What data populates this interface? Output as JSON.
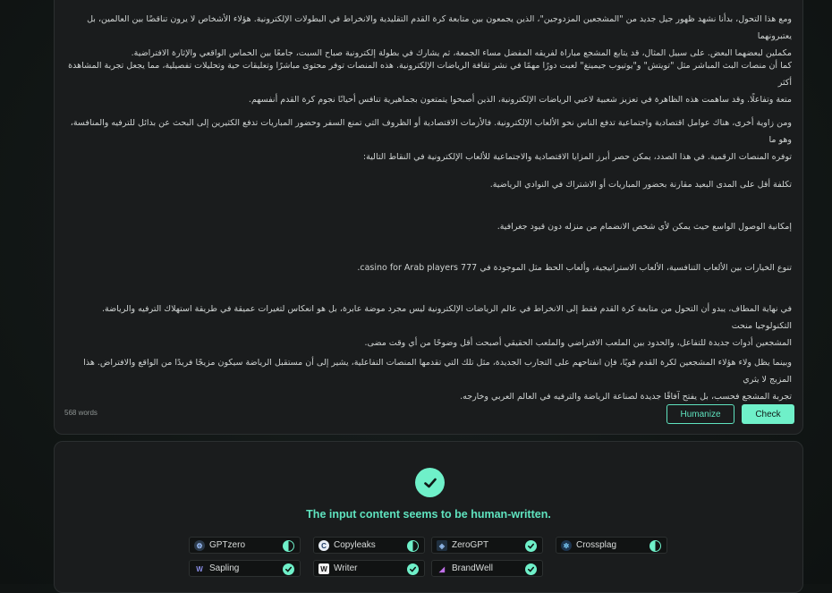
{
  "editor": {
    "paragraphs": [
      [
        "ومع هذا التحول، بدأنا نشهد ظهور جيل جديد من \"المشجعين المزدوجين\"، الذين يجمعون بين متابعة كرة القدم التقليدية والانخراط في البطولات الإلكترونية. هؤلاء الأشخاص لا يرون تناقضًا بين العالمين، بل يعتبرونهما",
        "مكملين لبعضهما البعض. على سبيل المثال، قد يتابع المشجع مباراة لفريقه المفضل مساء الجمعة، ثم يشارك في بطولة إلكترونية صباح السبت، جامعًا بين الحماس الواقعي والإثارة الافتراضية."
      ],
      [
        "كما أن منصات البث المباشر مثل \"تويتش\" و\"يوتيوب جيمينغ\" لعبت دورًا مهمًا في نشر ثقافة الرياضات الإلكترونية. هذه المنصات توفر محتوى مباشرًا وتعليقات حية وتحليلات تفصيلية، مما يجعل تجربة المشاهدة أكثر",
        "متعة وتفاعلًا. وقد ساهمت هذه الظاهرة في تعزيز شعبية لاعبي الرياضات الإلكترونية، الذين أصبحوا يتمتعون بجماهيرية تنافس أحيانًا نجوم كرة القدم أنفسهم."
      ],
      [
        "ومن زاوية أخرى، هناك عوامل اقتصادية واجتماعية تدفع الناس نحو الألعاب الإلكترونية. فالأزمات الاقتصادية أو الظروف التي تمنع السفر وحضور المباريات تدفع الكثيرين إلى البحث عن بدائل للترفيه والمنافسة، وهو ما",
        "توفره المنصات الرقمية. في هذا الصدد، يمكن حصر أبرز المزايا الاقتصادية والاجتماعية للألعاب الإلكترونية في النقاط التالية:"
      ],
      [
        "تكلفة أقل على المدى البعيد مقارنة بحضور المباريات أو الاشتراك في النوادي الرياضية."
      ],
      [
        "إمكانية الوصول الواسع حيث يمكن لأي شخص الانضمام من منزله دون قيود جغرافية."
      ],
      [
        "تنوع الخيارات بين الألعاب التنافسية، الألعاب الاستراتيجية، وألعاب الحظ مثل الموجودة في 777 casino for Arab players."
      ],
      [
        "في نهاية المطاف، يبدو أن التحول من متابعة كرة القدم فقط إلى الانخراط في عالم الرياضات الإلكترونية ليس مجرد موضة عابرة، بل هو انعكاس لتغيرات عميقة في طريقة استهلاك الترفيه والرياضة. التكنولوجيا منحت",
        "المشجعين أدوات جديدة للتفاعل، والحدود بين الملعب الافتراضي والملعب الحقيقي أصبحت أقل وضوحًا من أي وقت مضى."
      ],
      [
        "وبينما يظل ولاء هؤلاء المشجعين لكرة القدم قويًا، فإن انفتاحهم على التجارب الجديدة، مثل تلك التي تقدمها المنصات التفاعلية، يشير إلى أن مستقبل الرياضة سيكون مزيجًا فريدًا من الواقع والافتراض. هذا المزيج لا يثري",
        "تجربة المشجع فحسب، بل يفتح آفاقًا جديدة لصناعة الرياضة والترفيه في العالم العربي وخارجه."
      ]
    ],
    "word_count": "568 words",
    "humanize_label": "Humanize",
    "check_label": "Check"
  },
  "result": {
    "message": "The input content seems to be human-written.",
    "detectors": [
      {
        "name": "GPTzero",
        "icon": "gptzero-logo-icon",
        "status": "partial"
      },
      {
        "name": "Copyleaks",
        "icon": "copyleaks-logo-icon",
        "status": "partial"
      },
      {
        "name": "ZeroGPT",
        "icon": "zerogpt-logo-icon",
        "status": "pass"
      },
      {
        "name": "Crossplag",
        "icon": "crossplag-logo-icon",
        "status": "partial"
      },
      {
        "name": "Sapling",
        "icon": "sapling-logo-icon",
        "status": "pass"
      },
      {
        "name": "Writer",
        "icon": "writer-logo-icon",
        "status": "pass"
      },
      {
        "name": "BrandWell",
        "icon": "brandwell-logo-icon",
        "status": "pass"
      }
    ]
  },
  "colors": {
    "accent": "#6ff0c9",
    "background": "#121716",
    "card": "#1a1c1d"
  }
}
